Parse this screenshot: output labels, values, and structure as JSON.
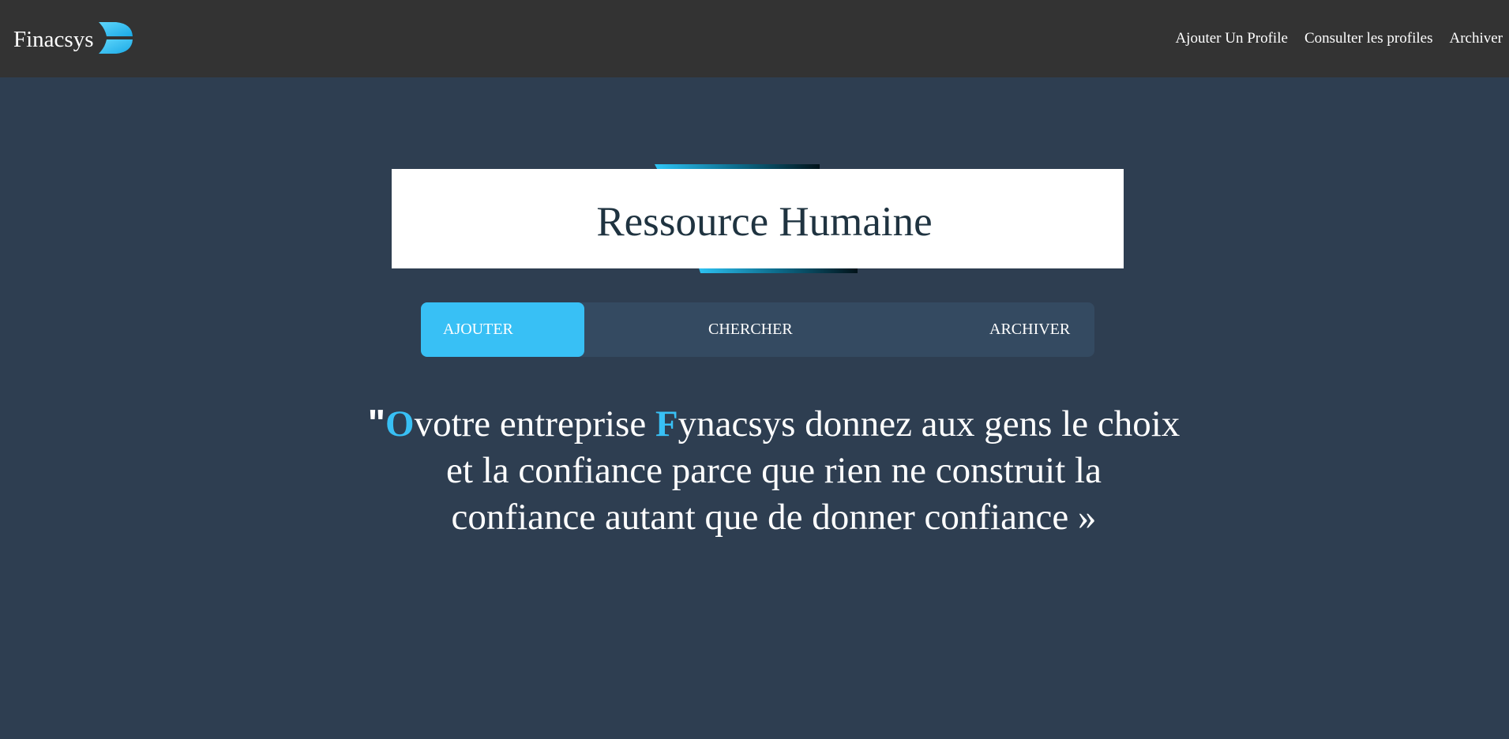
{
  "header": {
    "brand": "Finacsys",
    "nav": [
      {
        "label": "Ajouter Un Profile"
      },
      {
        "label": "Consulter les profiles"
      },
      {
        "label": "Archiver"
      }
    ]
  },
  "main": {
    "title": "Ressource Humaine",
    "tabs": [
      {
        "label": "AJOUTER",
        "active": true
      },
      {
        "label": "CHERCHER",
        "active": false
      },
      {
        "label": "ARCHIVER",
        "active": false
      }
    ],
    "quote": {
      "open_mark": "\"",
      "letter1": "O",
      "part1": "votre entreprise ",
      "letter2": "F",
      "line1_rest": "ynacsys donnez aux gens le choix",
      "line2": "et la confiance parce que rien ne construit la",
      "line3": "confiance autant que de donner confiance »"
    }
  },
  "colors": {
    "accent": "#38c0f5",
    "background": "#2e3e51",
    "navbar": "#333333",
    "tabs_bg": "#344a61"
  },
  "icons": {
    "logo": "finacsys-logo-icon"
  }
}
